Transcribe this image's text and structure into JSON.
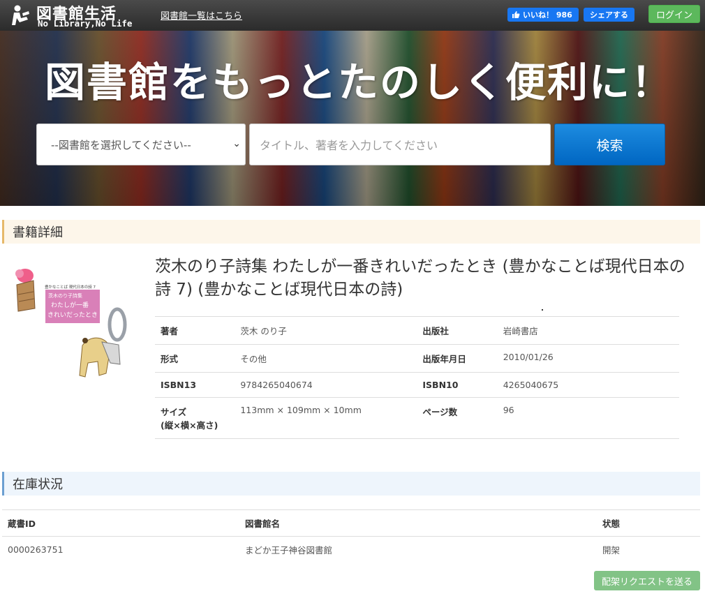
{
  "header": {
    "logo_title": "図書館生活",
    "logo_sub": "No Library,No Life",
    "library_list_link": "図書館一覧はこちら",
    "like_label": "いいね！ 986",
    "share_label": "シェアする",
    "login_label": "ログイン",
    "fb_color": "#1877f2",
    "login_color": "#5cb85c"
  },
  "hero": {
    "tagline": "図書館をもっとたのしく便利に！",
    "select_value": "--図書館を選択してください--",
    "search_placeholder": "タイトル、著者を入力してください",
    "search_button": "検索"
  },
  "detail": {
    "section_title": "書籍詳細",
    "book_title": "茨木のり子詩集 わたしが一番きれいだったとき (豊かなことば現代日本の詩 7) (豊かなことば現代日本の詩)",
    "cover_text": {
      "series": "豊かなことば 現代日本の詩 7",
      "author": "茨木のり子詩集",
      "title_line1": "わたしが一番",
      "title_line2": "きれいだったとき"
    },
    "fields": {
      "author_label": "著者",
      "author": "茨木 のり子",
      "publisher_label": "出版社",
      "publisher": "岩崎書店",
      "format_label": "形式",
      "format": "その他",
      "pubdate_label": "出版年月日",
      "pubdate": "2010/01/26",
      "isbn13_label": "ISBN13",
      "isbn13": "9784265040674",
      "isbn10_label": "ISBN10",
      "isbn10": "4265040675",
      "size_label_1": "サイズ",
      "size_label_2": "(縦×横×高さ)",
      "size": "113mm × 109mm × 10mm",
      "pages_label": "ページ数",
      "pages": "96"
    }
  },
  "stock": {
    "section_title": "在庫状況",
    "columns": [
      "蔵書ID",
      "図書館名",
      "状態"
    ],
    "rows": [
      {
        "id": "0000263751",
        "library": "まどか王子神谷図書館",
        "status": "開架"
      }
    ],
    "request_button": "配架リクエストを送る"
  }
}
